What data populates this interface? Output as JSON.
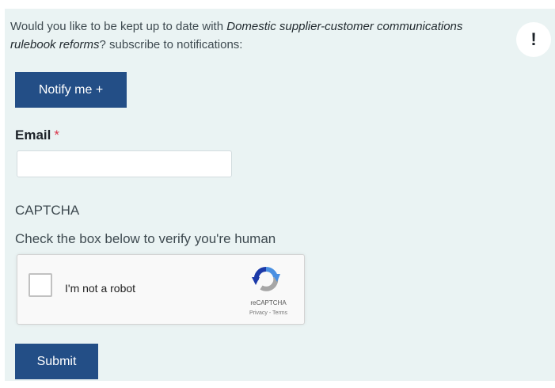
{
  "subscribe": {
    "intro_before": "Would you like to be kept up to date with ",
    "topic": "Domestic supplier-customer communications rulebook reforms",
    "intro_after": "? subscribe to notifications:",
    "alert_symbol": "!",
    "notify_label": "Notify me +"
  },
  "email": {
    "label": "Email",
    "required_marker": "*",
    "value": "",
    "placeholder": ""
  },
  "captcha": {
    "title": "CAPTCHA",
    "description": "Check the box below to verify you're human",
    "checkbox_label": "I'm not a robot",
    "checked": false,
    "brand": "reCAPTCHA",
    "privacy_link": "Privacy",
    "separator": " - ",
    "terms_link": "Terms"
  },
  "form": {
    "submit_label": "Submit"
  },
  "colors": {
    "button_bg": "#234e86",
    "panel_bg": "#eaf3f3",
    "required": "#d9364b"
  },
  "icons": {
    "alert": "exclamation-icon",
    "recaptcha": "recaptcha-logo-icon"
  }
}
